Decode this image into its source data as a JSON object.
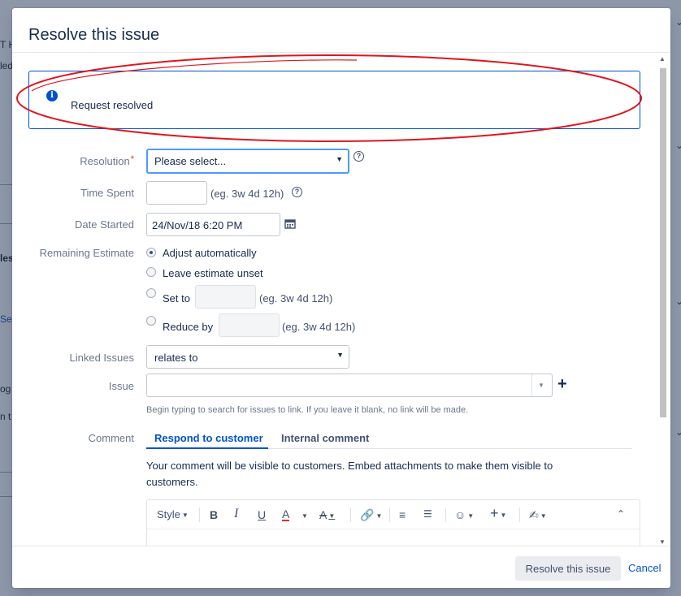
{
  "background": {
    "fragments": [
      "T H",
      "led",
      "les",
      "Sea",
      "og",
      "n t"
    ]
  },
  "dialog": {
    "title": "Resolve this issue",
    "info_message": "Request resolved",
    "annotation_color": "#e0161e",
    "fields": {
      "resolution": {
        "label": "Resolution",
        "required_mark": "*",
        "value": "Please select..."
      },
      "time_spent": {
        "label": "Time Spent",
        "value": "",
        "hint": "(eg. 3w 4d 12h)"
      },
      "date_started": {
        "label": "Date Started",
        "value": "24/Nov/18 6:20 PM"
      },
      "remaining_estimate": {
        "label": "Remaining Estimate",
        "options": [
          {
            "label": "Adjust automatically",
            "checked": true
          },
          {
            "label": "Leave estimate unset",
            "checked": false
          },
          {
            "label": "Set to",
            "checked": false,
            "hint": "(eg. 3w 4d 12h)"
          },
          {
            "label": "Reduce by",
            "checked": false,
            "hint": "(eg. 3w 4d 12h)"
          }
        ]
      },
      "linked_issues": {
        "label": "Linked Issues",
        "value": "relates to"
      },
      "issue": {
        "label": "Issue",
        "value": "",
        "help": "Begin typing to search for issues to link. If you leave it blank, no link will be made."
      },
      "comment": {
        "label": "Comment",
        "tabs": [
          {
            "label": "Respond to customer",
            "active": true
          },
          {
            "label": "Internal comment",
            "active": false
          }
        ],
        "notice": "Your comment will be visible to customers. Embed attachments to make them visible to customers.",
        "toolbar": {
          "style_label": "Style",
          "bold": "B",
          "italic": "I",
          "underline": "U",
          "text_color": "A",
          "clear_format": "A"
        }
      }
    },
    "footer": {
      "submit_label": "Resolve this issue",
      "cancel_label": "Cancel"
    }
  }
}
